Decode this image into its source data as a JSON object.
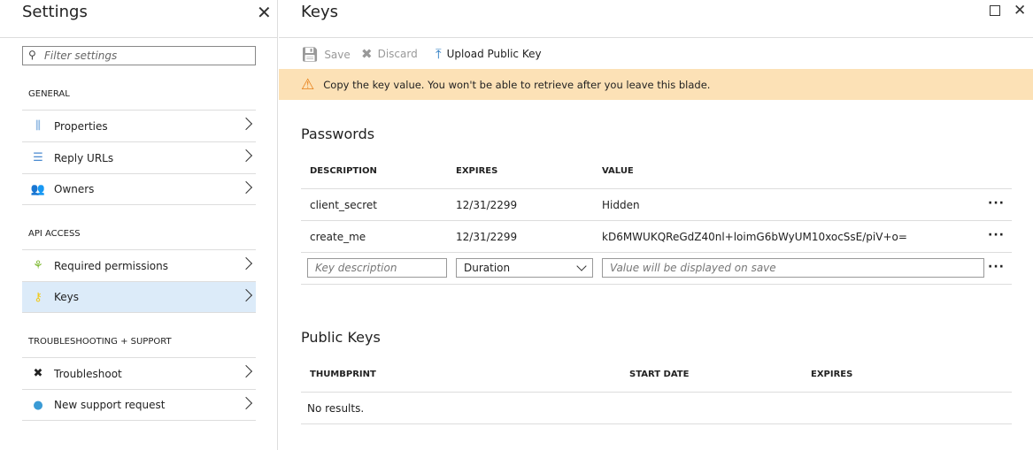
{
  "settings": {
    "title": "Settings",
    "filter_placeholder": "Filter settings",
    "sections": [
      {
        "label": "GENERAL"
      },
      {
        "label": "API ACCESS"
      },
      {
        "label": "TROUBLESHOOTING + SUPPORT"
      }
    ],
    "items": [
      {
        "label": "Properties",
        "icon": "properties-icon"
      },
      {
        "label": "Reply URLs",
        "icon": "list-icon"
      },
      {
        "label": "Owners",
        "icon": "owners-icon"
      },
      {
        "label": "Required permissions",
        "icon": "permissions-icon"
      },
      {
        "label": "Keys",
        "icon": "key-icon",
        "selected": true
      },
      {
        "label": "Troubleshoot",
        "icon": "tools-icon"
      },
      {
        "label": "New support request",
        "icon": "support-icon"
      }
    ]
  },
  "keys": {
    "title": "Keys",
    "toolbar": {
      "save": "Save",
      "discard": "Discard",
      "upload": "Upload Public Key"
    },
    "warning": "Copy the key value. You won't be able to retrieve after you leave this blade.",
    "passwords": {
      "title": "Passwords",
      "headers": [
        "DESCRIPTION",
        "EXPIRES",
        "VALUE"
      ],
      "rows": [
        {
          "description": "client_secret",
          "expires": "12/31/2299",
          "value": "Hidden"
        },
        {
          "description": "create_me",
          "expires": "12/31/2299",
          "value": "kD6MWUKQReGdZ40nl+loimG6bWyUM10xocSsE/piV+o="
        }
      ],
      "new_row": {
        "description_placeholder": "Key description",
        "duration": "Duration",
        "value_placeholder": "Value will be displayed on save"
      }
    },
    "public_keys": {
      "title": "Public Keys",
      "headers": [
        "THUMBPRINT",
        "START DATE",
        "EXPIRES"
      ],
      "empty": "No results."
    }
  },
  "colors": {
    "warning_bg": "#fce1b6",
    "selected_bg": "#dcebf9",
    "warning_icon": "#e8811a"
  }
}
